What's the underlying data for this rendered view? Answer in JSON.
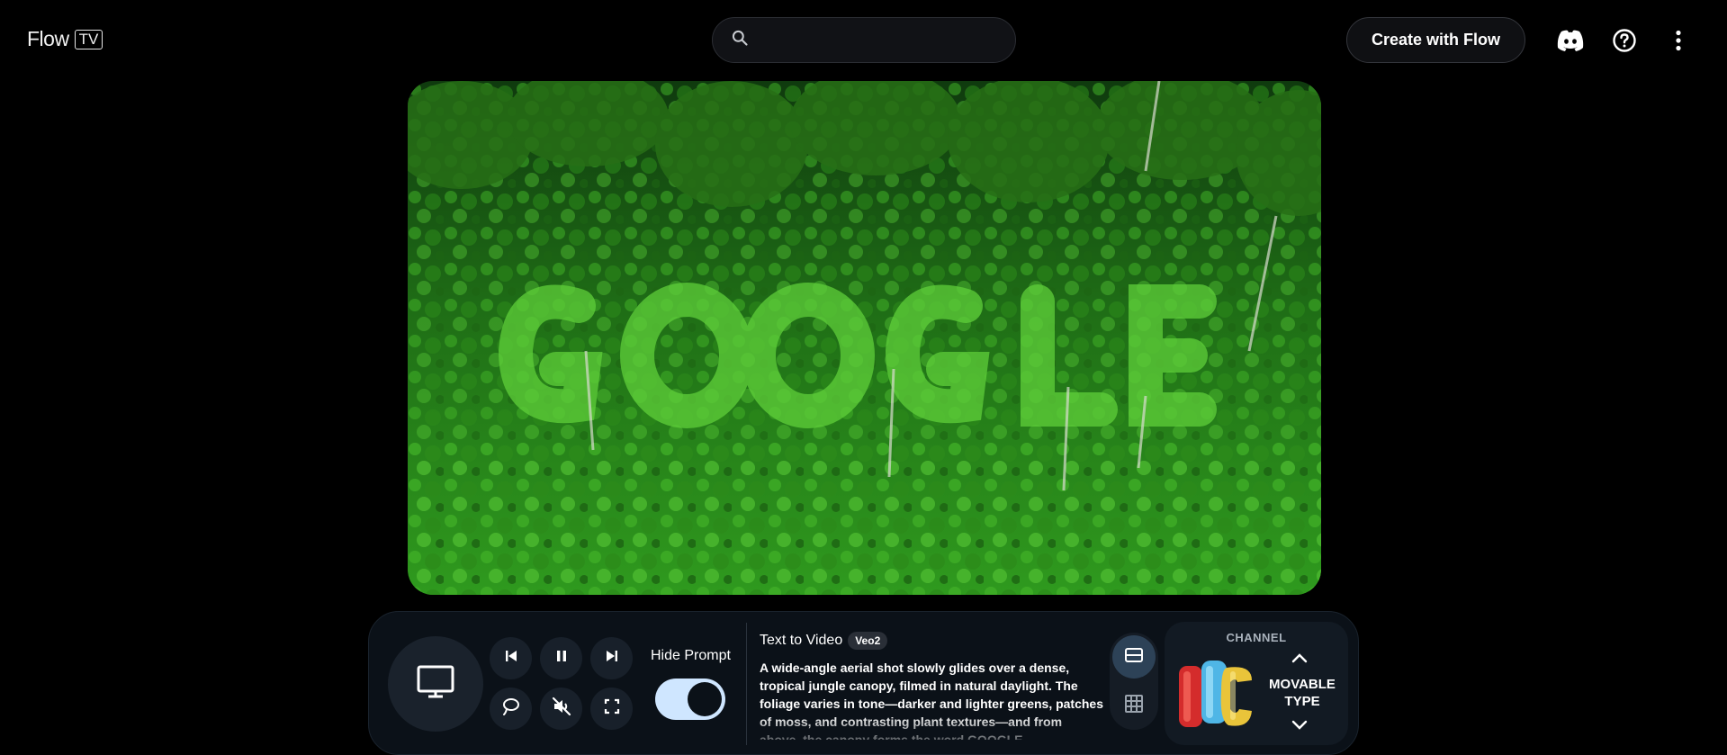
{
  "header": {
    "logo_text": "Flow",
    "logo_badge": "TV",
    "search": {
      "placeholder": "",
      "value": ""
    },
    "create_button": "Create with Flow",
    "icons": [
      "discord-icon",
      "help-icon",
      "more-vert-icon"
    ]
  },
  "video": {
    "description_icon": "jungle-canopy-video"
  },
  "controls": {
    "hide_prompt_label": "Hide Prompt",
    "hide_prompt_on": true,
    "buttons": [
      "tv-icon",
      "skip-previous-icon",
      "pause-icon",
      "skip-next-icon",
      "loop-icon",
      "volume-muted-icon",
      "fullscreen-icon"
    ]
  },
  "prompt": {
    "type": "Text to Video",
    "model": "Veo2",
    "text": "A wide-angle aerial shot slowly glides over a dense, tropical jungle canopy, filmed in natural daylight. The foliage varies in tone—darker and lighter greens, patches of moss, and contrasting plant textures—and from above, the canopy forms the word GOOGLE."
  },
  "channel": {
    "label": "CHANNEL",
    "name_line1": "MOVABLE",
    "name_line2": "TYPE"
  },
  "colors": {
    "background": "#000000",
    "panel": "#0b1118",
    "toggle_on": "#cfe6ff",
    "active_view": "#2d4257"
  }
}
